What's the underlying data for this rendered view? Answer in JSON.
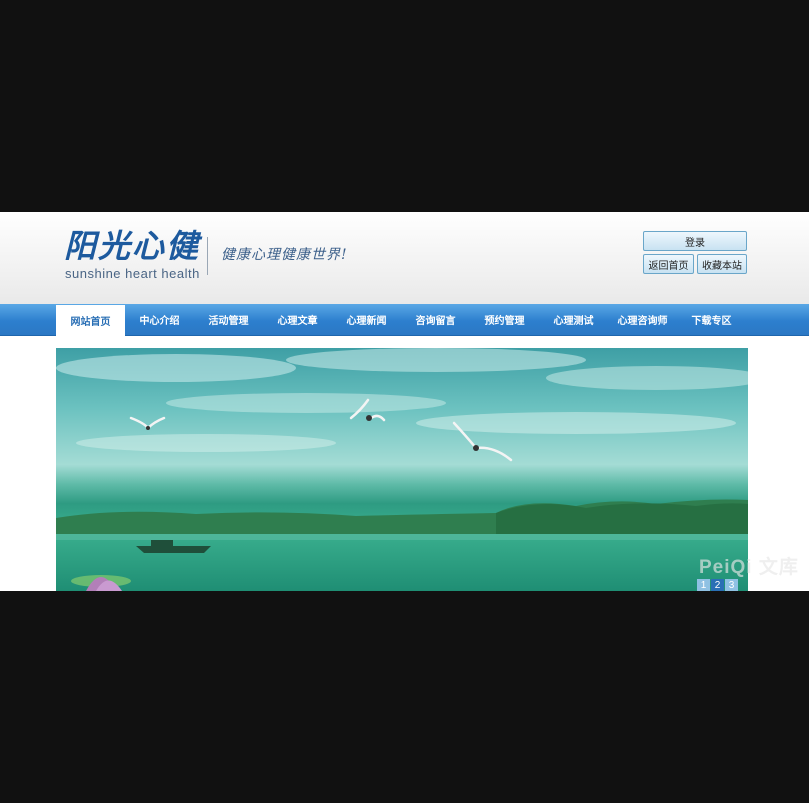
{
  "header": {
    "logo_cn": "阳光心健",
    "logo_en": "sunshine heart health",
    "slogan": "健康心理健康世界!",
    "login_label": "登录",
    "home_label": "返回首页",
    "favorite_label": "收藏本站"
  },
  "nav": {
    "items": [
      {
        "label": "网站首页",
        "active": true
      },
      {
        "label": "中心介绍"
      },
      {
        "label": "活动管理"
      },
      {
        "label": "心理文章"
      },
      {
        "label": "心理新闻"
      },
      {
        "label": "咨询留言"
      },
      {
        "label": "预约管理"
      },
      {
        "label": "心理测试"
      },
      {
        "label": "心理咨询师"
      },
      {
        "label": "下载专区"
      }
    ]
  },
  "banner": {
    "slides": [
      "1",
      "2",
      "3"
    ],
    "current_slide": 2
  },
  "watermark": "PeiQi 文库",
  "colors": {
    "nav_blue": "#2d7fce",
    "brand_blue": "#1d5a9e",
    "backdrop": "#111111"
  }
}
